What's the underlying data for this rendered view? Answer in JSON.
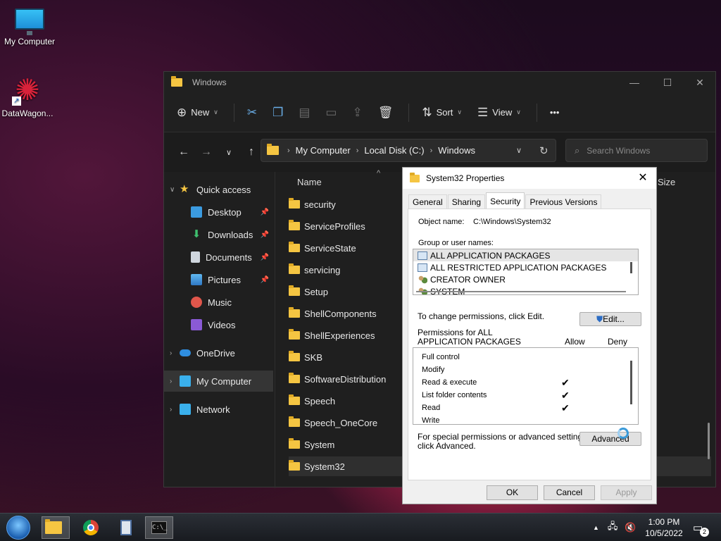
{
  "desktop": {
    "icons": [
      {
        "label": "My Computer",
        "icon": "monitor-icon"
      },
      {
        "label": "DataWagon...",
        "icon": "datawagon-icon"
      }
    ]
  },
  "explorer": {
    "title": "Windows",
    "toolbar": {
      "new_label": "New",
      "sort_label": "Sort",
      "view_label": "View",
      "more_label": "•••"
    },
    "address": {
      "crumbs": [
        "My Computer",
        "Local Disk (C:)",
        "Windows"
      ]
    },
    "search_placeholder": "Search Windows",
    "sidebar": {
      "quick_access": "Quick access",
      "items": [
        "Desktop",
        "Downloads",
        "Documents",
        "Pictures",
        "Music",
        "Videos"
      ],
      "onedrive": "OneDrive",
      "my_computer": "My Computer",
      "network": "Network"
    },
    "columns": {
      "name": "Name",
      "size": "Size"
    },
    "files": [
      "security",
      "ServiceProfiles",
      "ServiceState",
      "servicing",
      "Setup",
      "ShellComponents",
      "ShellExperiences",
      "SKB",
      "SoftwareDistribution",
      "Speech",
      "Speech_OneCore",
      "System",
      "System32"
    ]
  },
  "dialog": {
    "title": "System32 Properties",
    "tabs": [
      "General",
      "Sharing",
      "Security",
      "Previous Versions"
    ],
    "active_tab": "Security",
    "object_name_label": "Object name:",
    "object_name_value": "C:\\Windows\\System32",
    "group_label": "Group or user names:",
    "groups": [
      "ALL APPLICATION PACKAGES",
      "ALL RESTRICTED APPLICATION PACKAGES",
      "CREATOR OWNER",
      "SYSTEM"
    ],
    "change_text": "To change permissions, click Edit.",
    "edit_label": "Edit...",
    "perm_label_1": "Permissions for ALL",
    "perm_label_2": "APPLICATION PACKAGES",
    "allow_label": "Allow",
    "deny_label": "Deny",
    "permissions": [
      {
        "name": "Full control",
        "allow": false
      },
      {
        "name": "Modify",
        "allow": false
      },
      {
        "name": "Read & execute",
        "allow": true
      },
      {
        "name": "List folder contents",
        "allow": true
      },
      {
        "name": "Read",
        "allow": true
      },
      {
        "name": "Write",
        "allow": false
      }
    ],
    "special_1": "For special permissions or advanced settings,",
    "special_2": "click Advanced.",
    "advanced_label": "Advanced",
    "ok_label": "OK",
    "cancel_label": "Cancel",
    "apply_label": "Apply"
  },
  "taskbar": {
    "time": "1:00 PM",
    "date": "10/5/2022",
    "notification_count": "2"
  }
}
